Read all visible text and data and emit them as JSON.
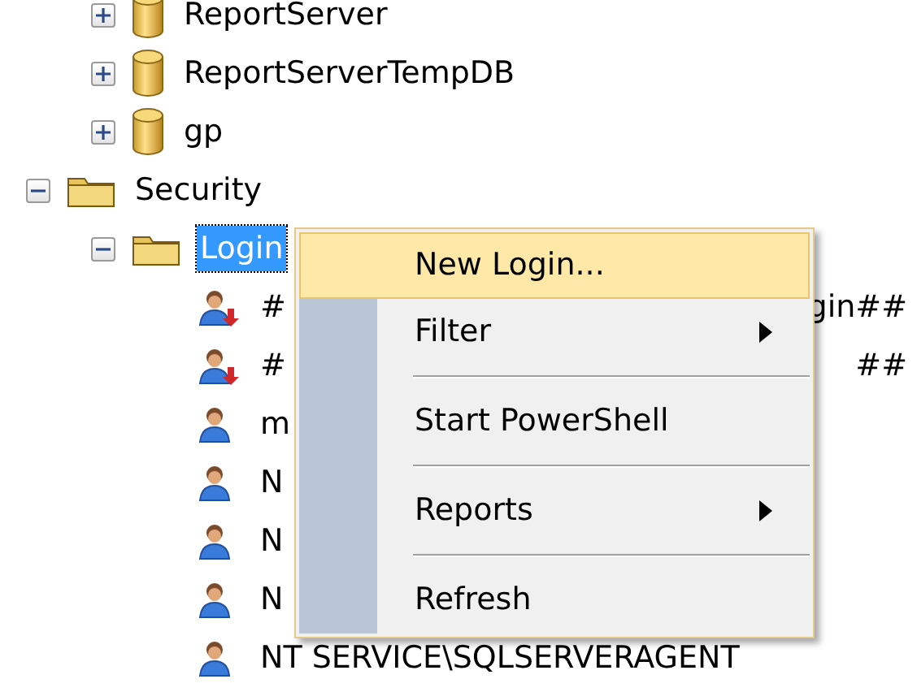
{
  "tree": [
    {
      "children": [
        {
          "label": "ReportServer",
          "kind": "database",
          "expanded": false
        },
        {
          "label": "ReportServerTempDB",
          "kind": "database",
          "expanded": false
        },
        {
          "label": "gp",
          "kind": "database",
          "expanded": false
        }
      ]
    },
    {
      "label": "Security",
      "kind": "folder",
      "expanded": true,
      "children": [
        {
          "label": "Login",
          "kind": "folder",
          "expanded": true,
          "selected": true,
          "children": [
            {
              "label": "#",
              "label_end": "gin##",
              "kind": "login",
              "disabled": true
            },
            {
              "label": "#",
              "label_end": "##",
              "kind": "login",
              "disabled": true
            },
            {
              "label": "m",
              "kind": "login",
              "disabled": false
            },
            {
              "label": "N",
              "kind": "login",
              "disabled": false
            },
            {
              "label": "N",
              "kind": "login",
              "disabled": false
            },
            {
              "label": "N",
              "kind": "login",
              "disabled": false
            },
            {
              "label": "NT SERVICE\\SQLSERVERAGENT",
              "kind": "login",
              "disabled": false
            }
          ]
        }
      ]
    }
  ],
  "context_menu": [
    {
      "kind": "item",
      "label": "New Login...",
      "selected": true,
      "submenu": false
    },
    {
      "kind": "item",
      "label": "Filter",
      "selected": false,
      "submenu": true
    },
    {
      "kind": "separator"
    },
    {
      "kind": "item",
      "label": "Start PowerShell",
      "selected": false,
      "submenu": false
    },
    {
      "kind": "separator"
    },
    {
      "kind": "item",
      "label": "Reports",
      "selected": false,
      "submenu": true
    },
    {
      "kind": "separator"
    },
    {
      "kind": "item",
      "label": "Refresh",
      "selected": false,
      "submenu": false
    }
  ]
}
